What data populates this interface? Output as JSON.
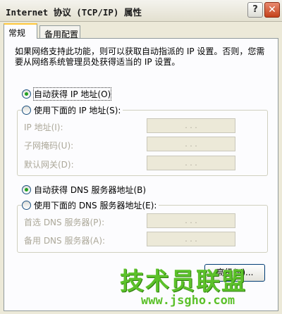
{
  "window": {
    "title": "Internet 协议 (TCP/IP) 属性",
    "help_glyph": "?",
    "close_glyph": "✕"
  },
  "tabs": [
    {
      "label": "常规",
      "active": true
    },
    {
      "label": "备用配置",
      "active": false
    }
  ],
  "intro_text": "如果网络支持此功能，则可以获取自动指派的 IP 设置。否则，您需要从网络系统管理员处获得适当的 IP 设置。",
  "ip": {
    "auto_label": "自动获得 IP 地址(O)",
    "auto_selected": true,
    "manual_label": "使用下面的 IP 地址(S):",
    "fields": [
      {
        "label": "IP 地址(I):",
        "value": ".   .   ."
      },
      {
        "label": "子网掩码(U):",
        "value": ".   .   ."
      },
      {
        "label": "默认网关(D):",
        "value": ".   .   ."
      }
    ]
  },
  "dns": {
    "auto_label": "自动获得 DNS 服务器地址(B)",
    "auto_selected": true,
    "manual_label": "使用下面的 DNS 服务器地址(E):",
    "fields": [
      {
        "label": "首选 DNS 服务器(P):",
        "value": ".   .   ."
      },
      {
        "label": "备用 DNS 服务器(A):",
        "value": ".   .   ."
      }
    ]
  },
  "advanced_button": "高级(V)...",
  "watermark": {
    "brand": "技术员联盟",
    "url": "www.jsgho.com"
  },
  "colors": {
    "accent_tab": "#ffc83c",
    "radio_dot": "#21a121",
    "close_button": "#c4411b",
    "watermark": "#5cc12a"
  }
}
